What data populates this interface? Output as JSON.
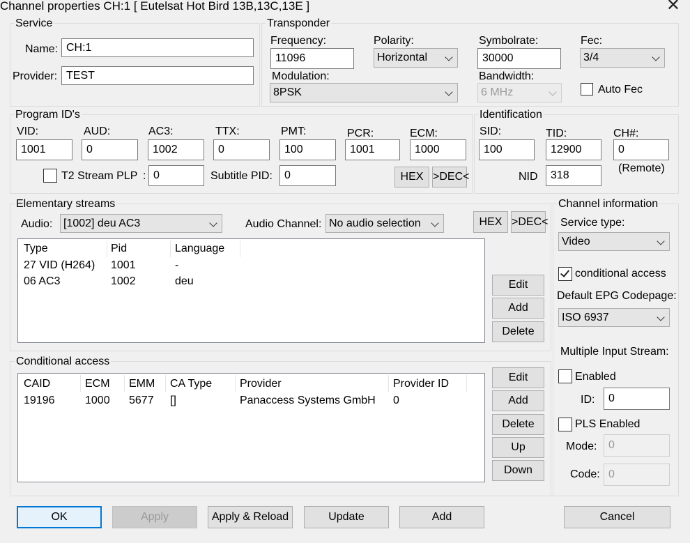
{
  "window": {
    "title": "Channel properties CH:1 [ Eutelsat Hot Bird 13B,13C,13E ]"
  },
  "service": {
    "group_label": "Service",
    "name_label": "Name:",
    "name_value": "CH:1",
    "provider_label": "Provider:",
    "provider_value": "TEST"
  },
  "transponder": {
    "group_label": "Transponder",
    "frequency_label": "Frequency:",
    "frequency_value": "11096",
    "polarity_label": "Polarity:",
    "polarity_value": "Horizontal",
    "symbolrate_label": "Symbolrate:",
    "symbolrate_value": "30000",
    "fec_label": "Fec:",
    "fec_value": "3/4",
    "modulation_label": "Modulation:",
    "modulation_value": "8PSK",
    "bandwidth_label": "Bandwidth:",
    "bandwidth_value": "6 MHz",
    "auto_fec_label": "Auto Fec",
    "auto_fec_checked": false
  },
  "program_ids": {
    "group_label": "Program ID's",
    "vid_label": "VID:",
    "vid_value": "1001",
    "aud_label": "AUD:",
    "aud_value": "0",
    "ac3_label": "AC3:",
    "ac3_value": "1002",
    "ttx_label": "TTX:",
    "ttx_value": "0",
    "pmt_label": "PMT:",
    "pmt_value": "100",
    "pcr_label": "PCR:",
    "pcr_value": "1001",
    "ecm_label": "ECM:",
    "ecm_value": "1000",
    "t2_label": "T2 Stream PLP",
    "t2_colon": ":",
    "t2_value": "0",
    "subtitle_label": "Subtitle PID:",
    "subtitle_value": "0",
    "hex_label": "HEX",
    "dec_label": ">DEC<"
  },
  "identification": {
    "group_label": "Identification",
    "sid_label": "SID:",
    "sid_value": "100",
    "tid_label": "TID:",
    "tid_value": "12900",
    "ch_label": "CH#:",
    "ch_value": "0",
    "remote_label": "(Remote)",
    "nid_label": "NID",
    "nid_value": "318"
  },
  "elementary": {
    "group_label": "Elementary streams",
    "audio_label": "Audio:",
    "audio_value": "[1002] deu AC3",
    "audio_channel_label": "Audio Channel:",
    "audio_channel_value": "No audio selection",
    "hex_label": "HEX",
    "dec_label": ">DEC<",
    "columns": [
      "Type",
      "Pid",
      "Language"
    ],
    "rows": [
      [
        "27 VID (H264)",
        "1001",
        "-"
      ],
      [
        "06 AC3",
        "1002",
        "deu"
      ]
    ],
    "edit_label": "Edit",
    "add_label": "Add",
    "delete_label": "Delete"
  },
  "conditional": {
    "group_label": "Conditional access",
    "columns": [
      "CAID",
      "ECM",
      "EMM",
      "CA Type",
      "Provider",
      "Provider ID"
    ],
    "rows": [
      [
        "19196",
        "1000",
        "5677",
        "[]",
        "Panaccess Systems GmbH",
        "0"
      ]
    ],
    "edit_label": "Edit",
    "add_label": "Add",
    "delete_label": "Delete",
    "up_label": "Up",
    "down_label": "Down"
  },
  "channel_info": {
    "group_label": "Channel information",
    "service_type_label": "Service type:",
    "service_type_value": "Video",
    "ca_label": "conditional access",
    "ca_checked": true,
    "epg_label": "Default EPG Codepage:",
    "epg_value": "ISO 6937",
    "mis_label": "Multiple Input Stream:",
    "enabled_label": "Enabled",
    "enabled_checked": false,
    "id_label": "ID:",
    "id_value": "0",
    "pls_label": "PLS Enabled",
    "pls_checked": false,
    "mode_label": "Mode:",
    "mode_value": "0",
    "code_label": "Code:",
    "code_value": "0"
  },
  "footer": {
    "ok_label": "OK",
    "apply_label": "Apply",
    "apply_reload_label": "Apply & Reload",
    "update_label": "Update",
    "add_label": "Add",
    "cancel_label": "Cancel"
  },
  "colors": {
    "focus_border": "#0078d7",
    "face": "#f0f0f0"
  }
}
